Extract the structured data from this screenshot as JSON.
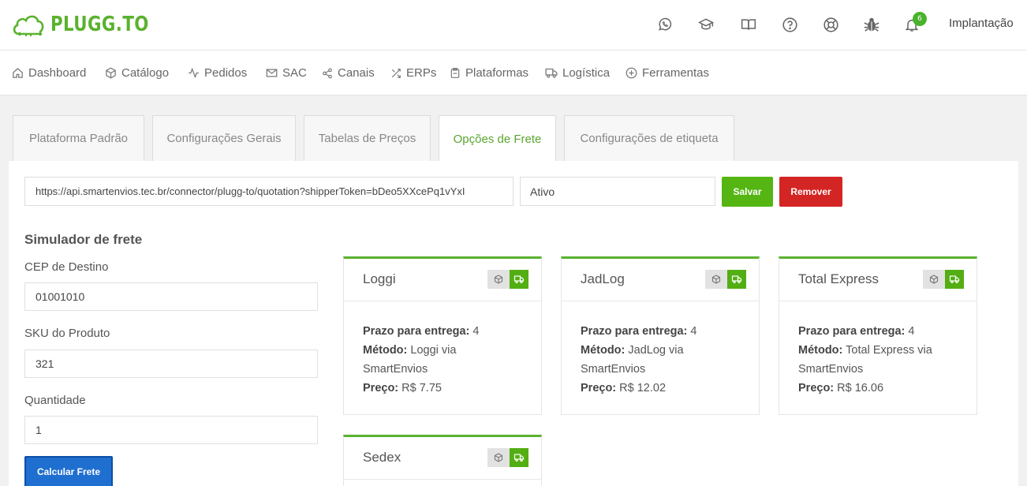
{
  "brand": {
    "name": "PLUGG.TO",
    "color": "#5ab22e"
  },
  "topbar": {
    "icons": [
      "whatsapp-icon",
      "graduation-cap-icon",
      "book-icon",
      "help-circle-icon",
      "lifebuoy-icon",
      "bug-icon",
      "bell-icon"
    ],
    "notification_count": "6",
    "user_label": "Implantação"
  },
  "nav": {
    "items": [
      {
        "label": "Dashboard",
        "icon": "home-icon"
      },
      {
        "label": "Catálogo",
        "icon": "cube-icon"
      },
      {
        "label": "Pedidos",
        "icon": "activity-icon"
      },
      {
        "label": "SAC",
        "icon": "mail-icon"
      },
      {
        "label": "Canais",
        "icon": "share-icon"
      },
      {
        "label": "ERPs",
        "icon": "shuffle-icon"
      },
      {
        "label": "Plataformas",
        "icon": "clipboard-icon"
      },
      {
        "label": "Logística",
        "icon": "truck-icon"
      },
      {
        "label": "Ferramentas",
        "icon": "plus-circle-icon"
      }
    ]
  },
  "tabs": [
    {
      "label": "Plataforma Padrão",
      "active": false
    },
    {
      "label": "Configurações Gerais",
      "active": false
    },
    {
      "label": "Tabelas de Preços",
      "active": false
    },
    {
      "label": "Opções de Frete",
      "active": true
    },
    {
      "label": "Configurações de etiqueta",
      "active": false
    }
  ],
  "integration": {
    "url_value": "https://api.smartenvios.tec.br/connector/plugg-to/quotation?shipperToken=bDeo5XXcePq1vYxI",
    "status_value": "Ativo",
    "save_label": "Salvar",
    "remove_label": "Remover"
  },
  "simulator": {
    "title": "Simulador de frete",
    "cep_label": "CEP de Destino",
    "cep_value": "01001010",
    "sku_label": "SKU do Produto",
    "sku_value": "321",
    "qty_label": "Quantidade",
    "qty_value": "1",
    "calc_label": "Calcular Frete"
  },
  "result_labels": {
    "prazo": "Prazo para entrega:",
    "metodo": "Método:",
    "preco": "Preço:"
  },
  "results": [
    {
      "name": "Loggi",
      "prazo": "4",
      "metodo_a": "Loggi via",
      "metodo_b": "SmartEnvios",
      "preco": "R$ 7.75"
    },
    {
      "name": "JadLog",
      "prazo": "4",
      "metodo_a": "JadLog via",
      "metodo_b": "SmartEnvios",
      "preco": "R$ 12.02"
    },
    {
      "name": "Total Express",
      "prazo": "4",
      "metodo_a": "Total Express via",
      "metodo_b": "SmartEnvios",
      "preco": "R$ 16.06"
    },
    {
      "name": "Sedex"
    }
  ],
  "colors": {
    "accent": "#5ab22e",
    "save": "#55b512",
    "remove": "#d42525",
    "calc": "#1f6fd0"
  }
}
